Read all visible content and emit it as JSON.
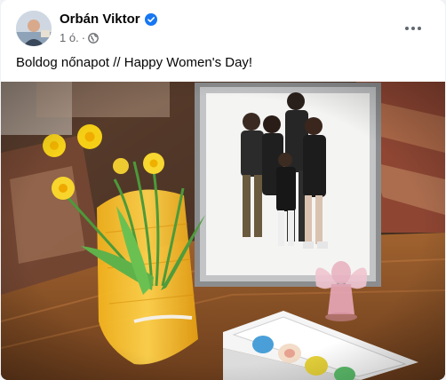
{
  "post": {
    "author": "Orbán Viktor",
    "time": "1 ó.",
    "separator": "·",
    "text": "Boldog nőnapot // Happy Women's Day!",
    "icons": {
      "verified": "verified-badge-icon",
      "audience": "globe-icon",
      "more": "more-options-icon"
    }
  },
  "colors": {
    "verified": "#1877f2",
    "name": "#050505",
    "meta": "#65676b"
  }
}
